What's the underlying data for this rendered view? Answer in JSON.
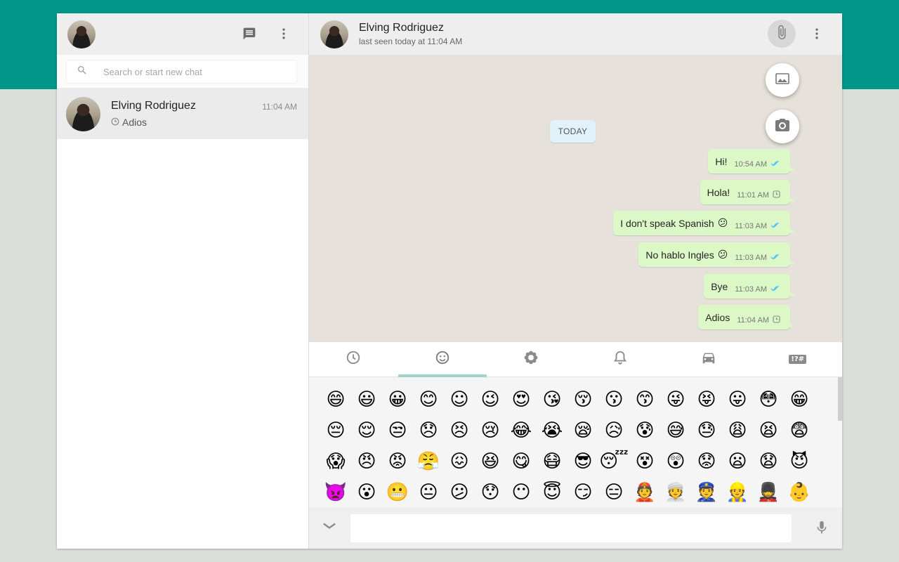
{
  "left": {
    "search_placeholder": "Search or start new chat",
    "chats": [
      {
        "name": "Elving Rodriguez",
        "last_message": "Adios",
        "time": "11:04 AM"
      }
    ]
  },
  "right": {
    "contact_name": "Elving Rodriguez",
    "contact_status": "last seen today at 11:04 AM",
    "date_chip": "TODAY",
    "messages": [
      {
        "text": "Hi!",
        "time": "10:54 AM",
        "status": "read"
      },
      {
        "text": "Hola!",
        "time": "11:01 AM",
        "status": "pending"
      },
      {
        "text": "I don't speak Spanish",
        "emoji": "😕",
        "time": "11:03 AM",
        "status": "read"
      },
      {
        "text": "No hablo Ingles",
        "emoji": "😕",
        "time": "11:03 AM",
        "status": "read"
      },
      {
        "text": "Bye",
        "time": "11:03 AM",
        "status": "read"
      },
      {
        "text": "Adios",
        "time": "11:04 AM",
        "status": "pending"
      }
    ]
  },
  "emoji_tabs": [
    "recent-icon",
    "smiley-icon",
    "flower-icon",
    "bell-icon",
    "car-icon",
    "symbols-icon"
  ],
  "emoji_tab_symbols_label": "!?#",
  "emojis": [
    [
      "😄",
      "😃",
      "😀",
      "😊",
      "☺",
      "😉",
      "😍",
      "😘",
      "😚",
      "😗",
      "😙",
      "😜",
      "😝",
      "😛",
      "😳",
      "😁"
    ],
    [
      "😔",
      "😌",
      "😒",
      "😞",
      "😣",
      "😢",
      "😂",
      "😭",
      "😪",
      "😥",
      "😰",
      "😅",
      "😓",
      "😩",
      "😫",
      "😨"
    ],
    [
      "😱",
      "😠",
      "😡",
      "😤",
      "😖",
      "😆",
      "😋",
      "😷",
      "😎",
      "😴",
      "😵",
      "😲",
      "😟",
      "😦",
      "😧",
      "😈"
    ],
    [
      "👿",
      "😮",
      "😬",
      "😐",
      "😕",
      "😯",
      "😶",
      "😇",
      "😏",
      "😑",
      "👲",
      "👳",
      "👮",
      "👷",
      "💂",
      "👶"
    ]
  ],
  "colors": {
    "brand": "#009688",
    "bubble_out": "#dcf8c6",
    "read_ticks": "#4fc3f7",
    "tab_indicator": "#9fd3cc"
  }
}
